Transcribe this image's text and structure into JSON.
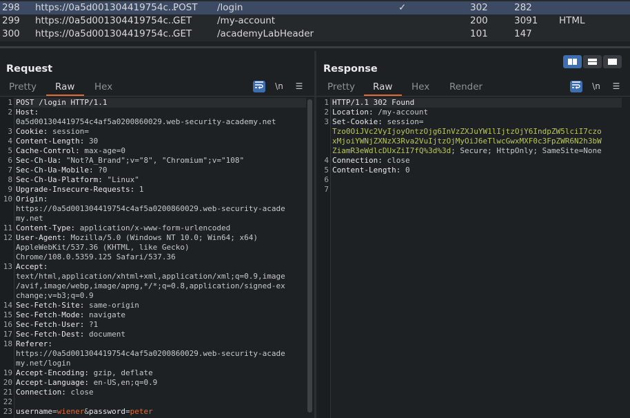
{
  "history": {
    "rows": [
      {
        "num": "298",
        "host": "https://0a5d001304419754c...",
        "method": "POST",
        "url": "/login",
        "edited": "✓",
        "status": "302",
        "length": "282",
        "mime": ""
      },
      {
        "num": "299",
        "host": "https://0a5d001304419754c...",
        "method": "GET",
        "url": "/my-account",
        "edited": "",
        "status": "200",
        "length": "3091",
        "mime": "HTML"
      },
      {
        "num": "300",
        "host": "https://0a5d001304419754c...",
        "method": "GET",
        "url": "/academyLabHeader",
        "edited": "",
        "status": "101",
        "length": "147",
        "mime": ""
      }
    ]
  },
  "request": {
    "title": "Request",
    "tabs": [
      "Pretty",
      "Raw",
      "Hex"
    ],
    "active_tab": "Raw",
    "tools": {
      "wrap": "wrap-lines-icon",
      "newline": "\\n",
      "menu": "☰"
    },
    "lines": [
      {
        "n": "1",
        "parts": [
          {
            "t": "POST /login HTTP/1.1",
            "c": "key"
          }
        ]
      },
      {
        "n": "2",
        "parts": [
          {
            "t": "Host:",
            "c": "key"
          }
        ]
      },
      {
        "n": "",
        "parts": [
          {
            "t": "0a5d001304419754c4af5a0200860029.web-security-academy.net",
            "c": "val"
          }
        ]
      },
      {
        "n": "3",
        "parts": [
          {
            "t": "Cookie: ",
            "c": "key"
          },
          {
            "t": "session=",
            "c": "val"
          }
        ]
      },
      {
        "n": "4",
        "parts": [
          {
            "t": "Content-Length: ",
            "c": "key"
          },
          {
            "t": "30",
            "c": "val"
          }
        ]
      },
      {
        "n": "5",
        "parts": [
          {
            "t": "Cache-Control: ",
            "c": "key"
          },
          {
            "t": "max-age=0",
            "c": "val"
          }
        ]
      },
      {
        "n": "6",
        "parts": [
          {
            "t": "Sec-Ch-Ua: ",
            "c": "key"
          },
          {
            "t": "\"Not?A_Brand\";v=\"8\", \"Chromium\";v=\"108\"",
            "c": "val"
          }
        ]
      },
      {
        "n": "7",
        "parts": [
          {
            "t": "Sec-Ch-Ua-Mobile: ",
            "c": "key"
          },
          {
            "t": "?0",
            "c": "val"
          }
        ]
      },
      {
        "n": "8",
        "parts": [
          {
            "t": "Sec-Ch-Ua-Platform: ",
            "c": "key"
          },
          {
            "t": "\"Linux\"",
            "c": "val"
          }
        ]
      },
      {
        "n": "9",
        "parts": [
          {
            "t": "Upgrade-Insecure-Requests: ",
            "c": "key"
          },
          {
            "t": "1",
            "c": "val"
          }
        ]
      },
      {
        "n": "10",
        "parts": [
          {
            "t": "Origin:",
            "c": "key"
          }
        ]
      },
      {
        "n": "",
        "parts": [
          {
            "t": "https://0a5d001304419754c4af5a0200860029.web-security-acade",
            "c": "val"
          }
        ]
      },
      {
        "n": "",
        "parts": [
          {
            "t": "my.net",
            "c": "val"
          }
        ]
      },
      {
        "n": "11",
        "parts": [
          {
            "t": "Content-Type: ",
            "c": "key"
          },
          {
            "t": "application/x-www-form-urlencoded",
            "c": "val"
          }
        ]
      },
      {
        "n": "12",
        "parts": [
          {
            "t": "User-Agent: ",
            "c": "key"
          },
          {
            "t": "Mozilla/5.0 (Windows NT 10.0; Win64; x64)",
            "c": "val"
          }
        ]
      },
      {
        "n": "",
        "parts": [
          {
            "t": "AppleWebKit/537.36 (KHTML, like Gecko)",
            "c": "val"
          }
        ]
      },
      {
        "n": "",
        "parts": [
          {
            "t": "Chrome/108.0.5359.125 Safari/537.36",
            "c": "val"
          }
        ]
      },
      {
        "n": "13",
        "parts": [
          {
            "t": "Accept:",
            "c": "key"
          }
        ]
      },
      {
        "n": "",
        "parts": [
          {
            "t": "text/html,application/xhtml+xml,application/xml;q=0.9,image",
            "c": "val"
          }
        ]
      },
      {
        "n": "",
        "parts": [
          {
            "t": "/avif,image/webp,image/apng,*/*;q=0.8,application/signed-ex",
            "c": "val"
          }
        ]
      },
      {
        "n": "",
        "parts": [
          {
            "t": "change;v=b3;q=0.9",
            "c": "val"
          }
        ]
      },
      {
        "n": "14",
        "parts": [
          {
            "t": "Sec-Fetch-Site: ",
            "c": "key"
          },
          {
            "t": "same-origin",
            "c": "val"
          }
        ]
      },
      {
        "n": "15",
        "parts": [
          {
            "t": "Sec-Fetch-Mode: ",
            "c": "key"
          },
          {
            "t": "navigate",
            "c": "val"
          }
        ]
      },
      {
        "n": "16",
        "parts": [
          {
            "t": "Sec-Fetch-User: ",
            "c": "key"
          },
          {
            "t": "?1",
            "c": "val"
          }
        ]
      },
      {
        "n": "17",
        "parts": [
          {
            "t": "Sec-Fetch-Dest: ",
            "c": "key"
          },
          {
            "t": "document",
            "c": "val"
          }
        ]
      },
      {
        "n": "18",
        "parts": [
          {
            "t": "Referer:",
            "c": "key"
          }
        ]
      },
      {
        "n": "",
        "parts": [
          {
            "t": "https://0a5d001304419754c4af5a0200860029.web-security-acade",
            "c": "val"
          }
        ]
      },
      {
        "n": "",
        "parts": [
          {
            "t": "my.net/login",
            "c": "val"
          }
        ]
      },
      {
        "n": "19",
        "parts": [
          {
            "t": "Accept-Encoding: ",
            "c": "key"
          },
          {
            "t": "gzip, deflate",
            "c": "val"
          }
        ]
      },
      {
        "n": "20",
        "parts": [
          {
            "t": "Accept-Language: ",
            "c": "key"
          },
          {
            "t": "en-US,en;q=0.9",
            "c": "val"
          }
        ]
      },
      {
        "n": "21",
        "parts": [
          {
            "t": "Connection: ",
            "c": "key"
          },
          {
            "t": "close",
            "c": "val"
          }
        ]
      },
      {
        "n": "22",
        "parts": []
      },
      {
        "n": "23",
        "parts": [
          {
            "t": "username",
            "c": "key"
          },
          {
            "t": "=",
            "c": "val"
          },
          {
            "t": "wiener",
            "c": "hl"
          },
          {
            "t": "&",
            "c": "val"
          },
          {
            "t": "password",
            "c": "key"
          },
          {
            "t": "=",
            "c": "val"
          },
          {
            "t": "peter",
            "c": "hl"
          }
        ]
      }
    ]
  },
  "response": {
    "title": "Response",
    "tabs": [
      "Pretty",
      "Raw",
      "Hex",
      "Render"
    ],
    "active_tab": "Raw",
    "tools": {
      "wrap": "wrap-lines-icon",
      "newline": "\\n",
      "menu": "☰"
    },
    "layout_buttons": [
      "side-by-side-layout-icon",
      "top-bottom-layout-icon",
      "tabbed-layout-icon"
    ],
    "lines": [
      {
        "n": "1",
        "parts": [
          {
            "t": "HTTP/1.1 302 Found",
            "c": "key"
          }
        ]
      },
      {
        "n": "2",
        "parts": [
          {
            "t": "Location: ",
            "c": "key"
          },
          {
            "t": "/my-account",
            "c": "val"
          }
        ]
      },
      {
        "n": "3",
        "parts": [
          {
            "t": "Set-Cookie: ",
            "c": "key"
          },
          {
            "t": "session=",
            "c": "val"
          }
        ]
      },
      {
        "n": "",
        "parts": [
          {
            "t": "Tzo0OiJVc2VyIjoyOntzOjg6InVzZXJuYW1lIjtzOjY6IndpZW5lciI7czo",
            "c": "cookie"
          }
        ]
      },
      {
        "n": "",
        "parts": [
          {
            "t": "xMjoiYWNjZXNzX3Rva2VuIjtzOjMyOiJ6eTlwcGwxMXF0c3FpZWR6N2h3bW",
            "c": "cookie"
          }
        ]
      },
      {
        "n": "",
        "parts": [
          {
            "t": "ZiamR3eWdlcDUxZiI7fQ%3d%3d",
            "c": "cookie"
          },
          {
            "t": "; Secure; HttpOnly; SameSite=None",
            "c": "val"
          }
        ]
      },
      {
        "n": "4",
        "parts": [
          {
            "t": "Connection: ",
            "c": "key"
          },
          {
            "t": "close",
            "c": "val"
          }
        ]
      },
      {
        "n": "5",
        "parts": [
          {
            "t": "Content-Length: ",
            "c": "key"
          },
          {
            "t": "0",
            "c": "val"
          }
        ]
      },
      {
        "n": "6",
        "parts": []
      },
      {
        "n": "7",
        "parts": []
      }
    ]
  },
  "colors": {
    "accent": "#e36b32",
    "selection": "#3d4a63",
    "button_active": "#3d6fb0",
    "cookie_value": "#b7c85a"
  }
}
